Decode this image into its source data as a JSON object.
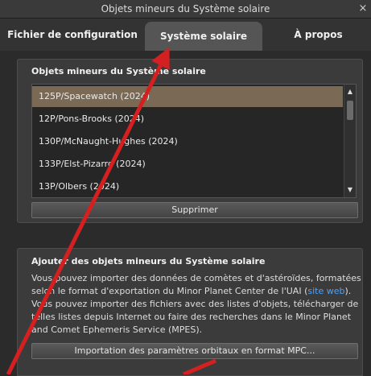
{
  "window": {
    "title": "Objets mineurs du Système solaire",
    "close_glyph": "×"
  },
  "tabs": [
    {
      "label": "Fichier de configuration"
    },
    {
      "label": "Système solaire",
      "active": true
    },
    {
      "label": "À propos"
    }
  ],
  "list_section": {
    "title": "Objets mineurs du Système solaire",
    "items": [
      "125P/Spacewatch (2024)",
      "12P/Pons-Brooks (2024)",
      "130P/McNaught-Hughes (2024)",
      "133P/Elst-Pizarro (2024)",
      "13P/Olbers (2024)"
    ],
    "selected_index": 0,
    "scroll_up_glyph": "▲",
    "scroll_down_glyph": "▼",
    "delete_label": "Supprimer"
  },
  "import_section": {
    "title": "Ajouter des objets mineurs du Système solaire",
    "desc_part1": "Vous pouvez importer des données de comètes et d'astéroïdes, formatées selon le format d'exportation du Minor Planet Center de l'UAI (",
    "desc_link": "site web",
    "desc_part2": "). Vous pouvez importer des fichiers avec des listes d'objets, télécharger de telles listes depuis Internet ou faire des recherches dans le Minor Planet and Comet Ephemeris Service (MPES).",
    "import_label": "Importation des paramètres orbitaux en format MPC..."
  },
  "colors": {
    "arrow": "#d42020",
    "link": "#4aa3ff",
    "selection": "#7a6a55"
  }
}
